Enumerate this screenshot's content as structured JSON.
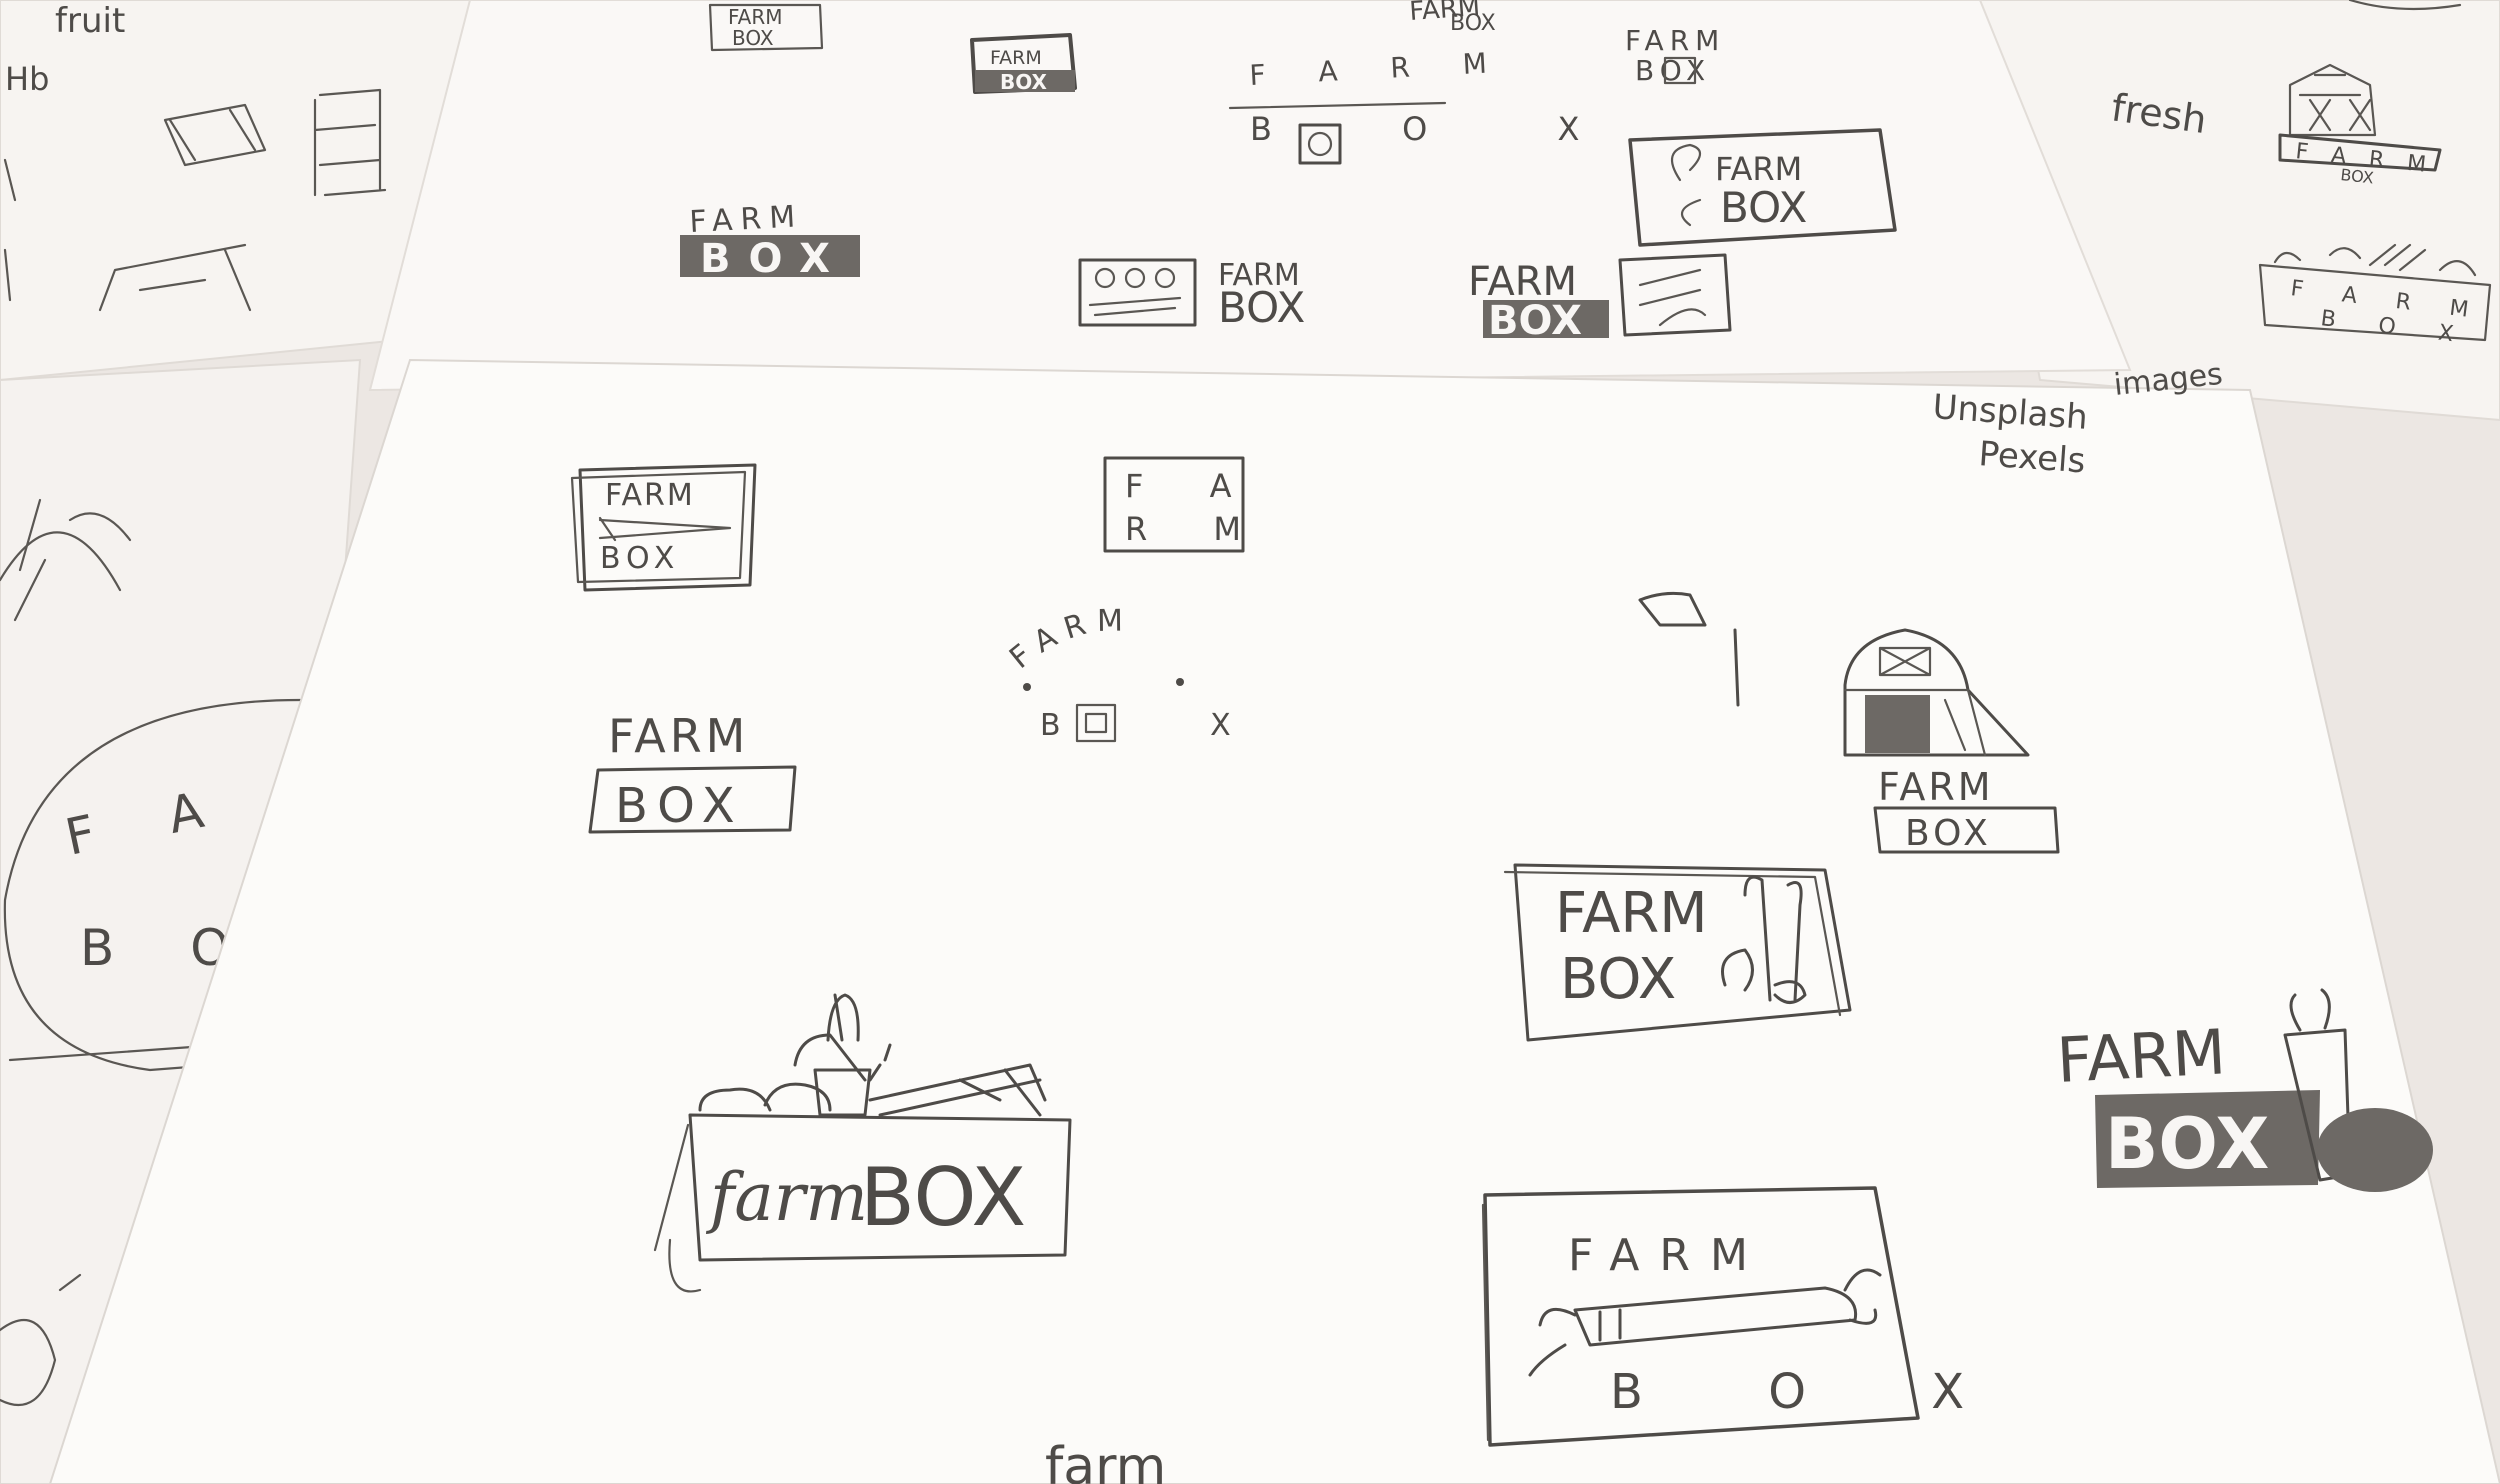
{
  "colors": {
    "background": "#ece7e3",
    "paper": "#f8f6f4",
    "paper_shadow": "#e4dfdb",
    "ink": "#4e4b48",
    "ink_fill": "#6d6965"
  },
  "sheet_top_left": {
    "notes": [
      "fruit",
      "Hb"
    ]
  },
  "sheet_top_center": {
    "sketches": [
      {
        "top": "FARM",
        "bottom": "BOX"
      },
      {
        "top": "FARM",
        "bottom": "BOX"
      },
      {
        "top": "FARM",
        "bottom": "BOX"
      },
      {
        "top": "F A R M",
        "bottom": "B O X"
      },
      {
        "top": "FARM",
        "bottom": "BOX"
      },
      {
        "top": "FARM",
        "bottom": "BOX"
      },
      {
        "top": "FARM",
        "bottom": "BOX"
      },
      {
        "top": "FARM",
        "bottom": "BOX"
      },
      {
        "top": "FARM",
        "bottom": "BOX"
      }
    ]
  },
  "sheet_top_right": {
    "notes": [
      "fresh"
    ],
    "sketches": [
      {
        "top": "F A R M",
        "bottom": "BOX"
      },
      {
        "top": "F A R M",
        "bottom": "B O X"
      }
    ]
  },
  "sheet_left_behind": {
    "sketches": [
      {
        "top": "F A R",
        "bottom": "B O"
      }
    ]
  },
  "sheet_main": {
    "notes": [
      "images",
      "Unsplash",
      "Pexels",
      "farm"
    ],
    "sketches": [
      {
        "top": "FARM",
        "bottom": "BOX"
      },
      {
        "top": "F A",
        "bottom": "R M"
      },
      {
        "top": "F A R M",
        "bottom": "B X"
      },
      {
        "top": "FARM",
        "bottom": "BOX"
      },
      {
        "top": "FARM",
        "bottom": "BOX"
      },
      {
        "top": "FARM",
        "bottom": "BOX"
      },
      {
        "top": "farm",
        "bottom": "BOX"
      },
      {
        "top": "FARM",
        "bottom": "B O X"
      },
      {
        "top": "FARM",
        "bottom": "BOX"
      }
    ]
  }
}
